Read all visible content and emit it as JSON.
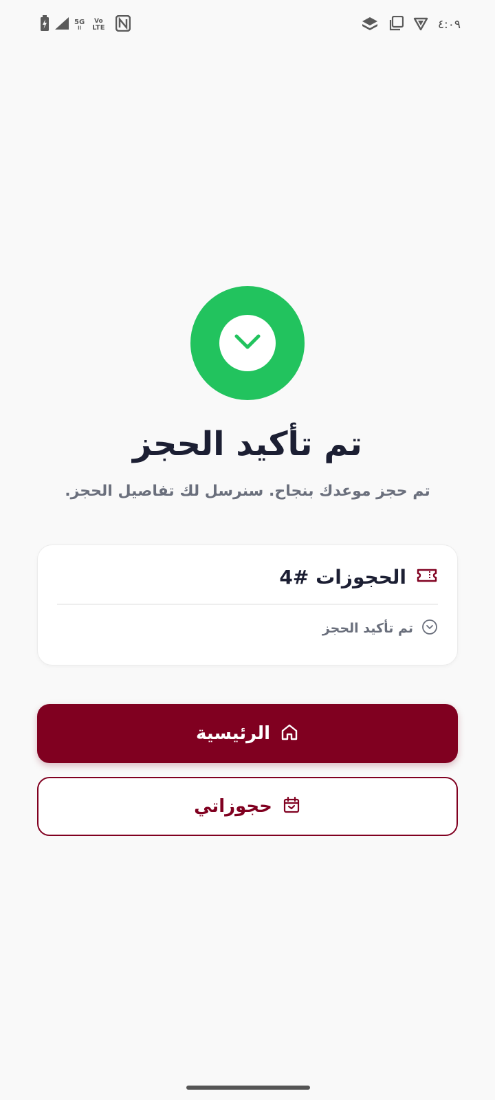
{
  "status_bar": {
    "network_5g": "5G",
    "network_5g_sub": "ll",
    "volte_top": "Vo",
    "volte_bottom": "LTE",
    "time": "٤:٠٩"
  },
  "confirmation": {
    "title": "تم تأكيد الحجز",
    "subtitle": "تم حجز موعدك بنجاح. سنرسل لك تفاصيل الحجز."
  },
  "booking_card": {
    "title": "الحجوزات #4",
    "status": "تم تأكيد الحجز"
  },
  "actions": {
    "home_label": "الرئيسية",
    "my_bookings_label": "حجوزاتي"
  },
  "colors": {
    "brand": "#800020",
    "success": "#22c35e",
    "background": "#f9f9f9",
    "title_text": "#1c1f33",
    "muted_text": "#6a6f7c"
  },
  "icons": {
    "success": "check-chevron-icon",
    "card": "ticket-icon",
    "status": "chevron-circle-icon",
    "home": "home-icon",
    "bookings": "calendar-check-icon"
  }
}
